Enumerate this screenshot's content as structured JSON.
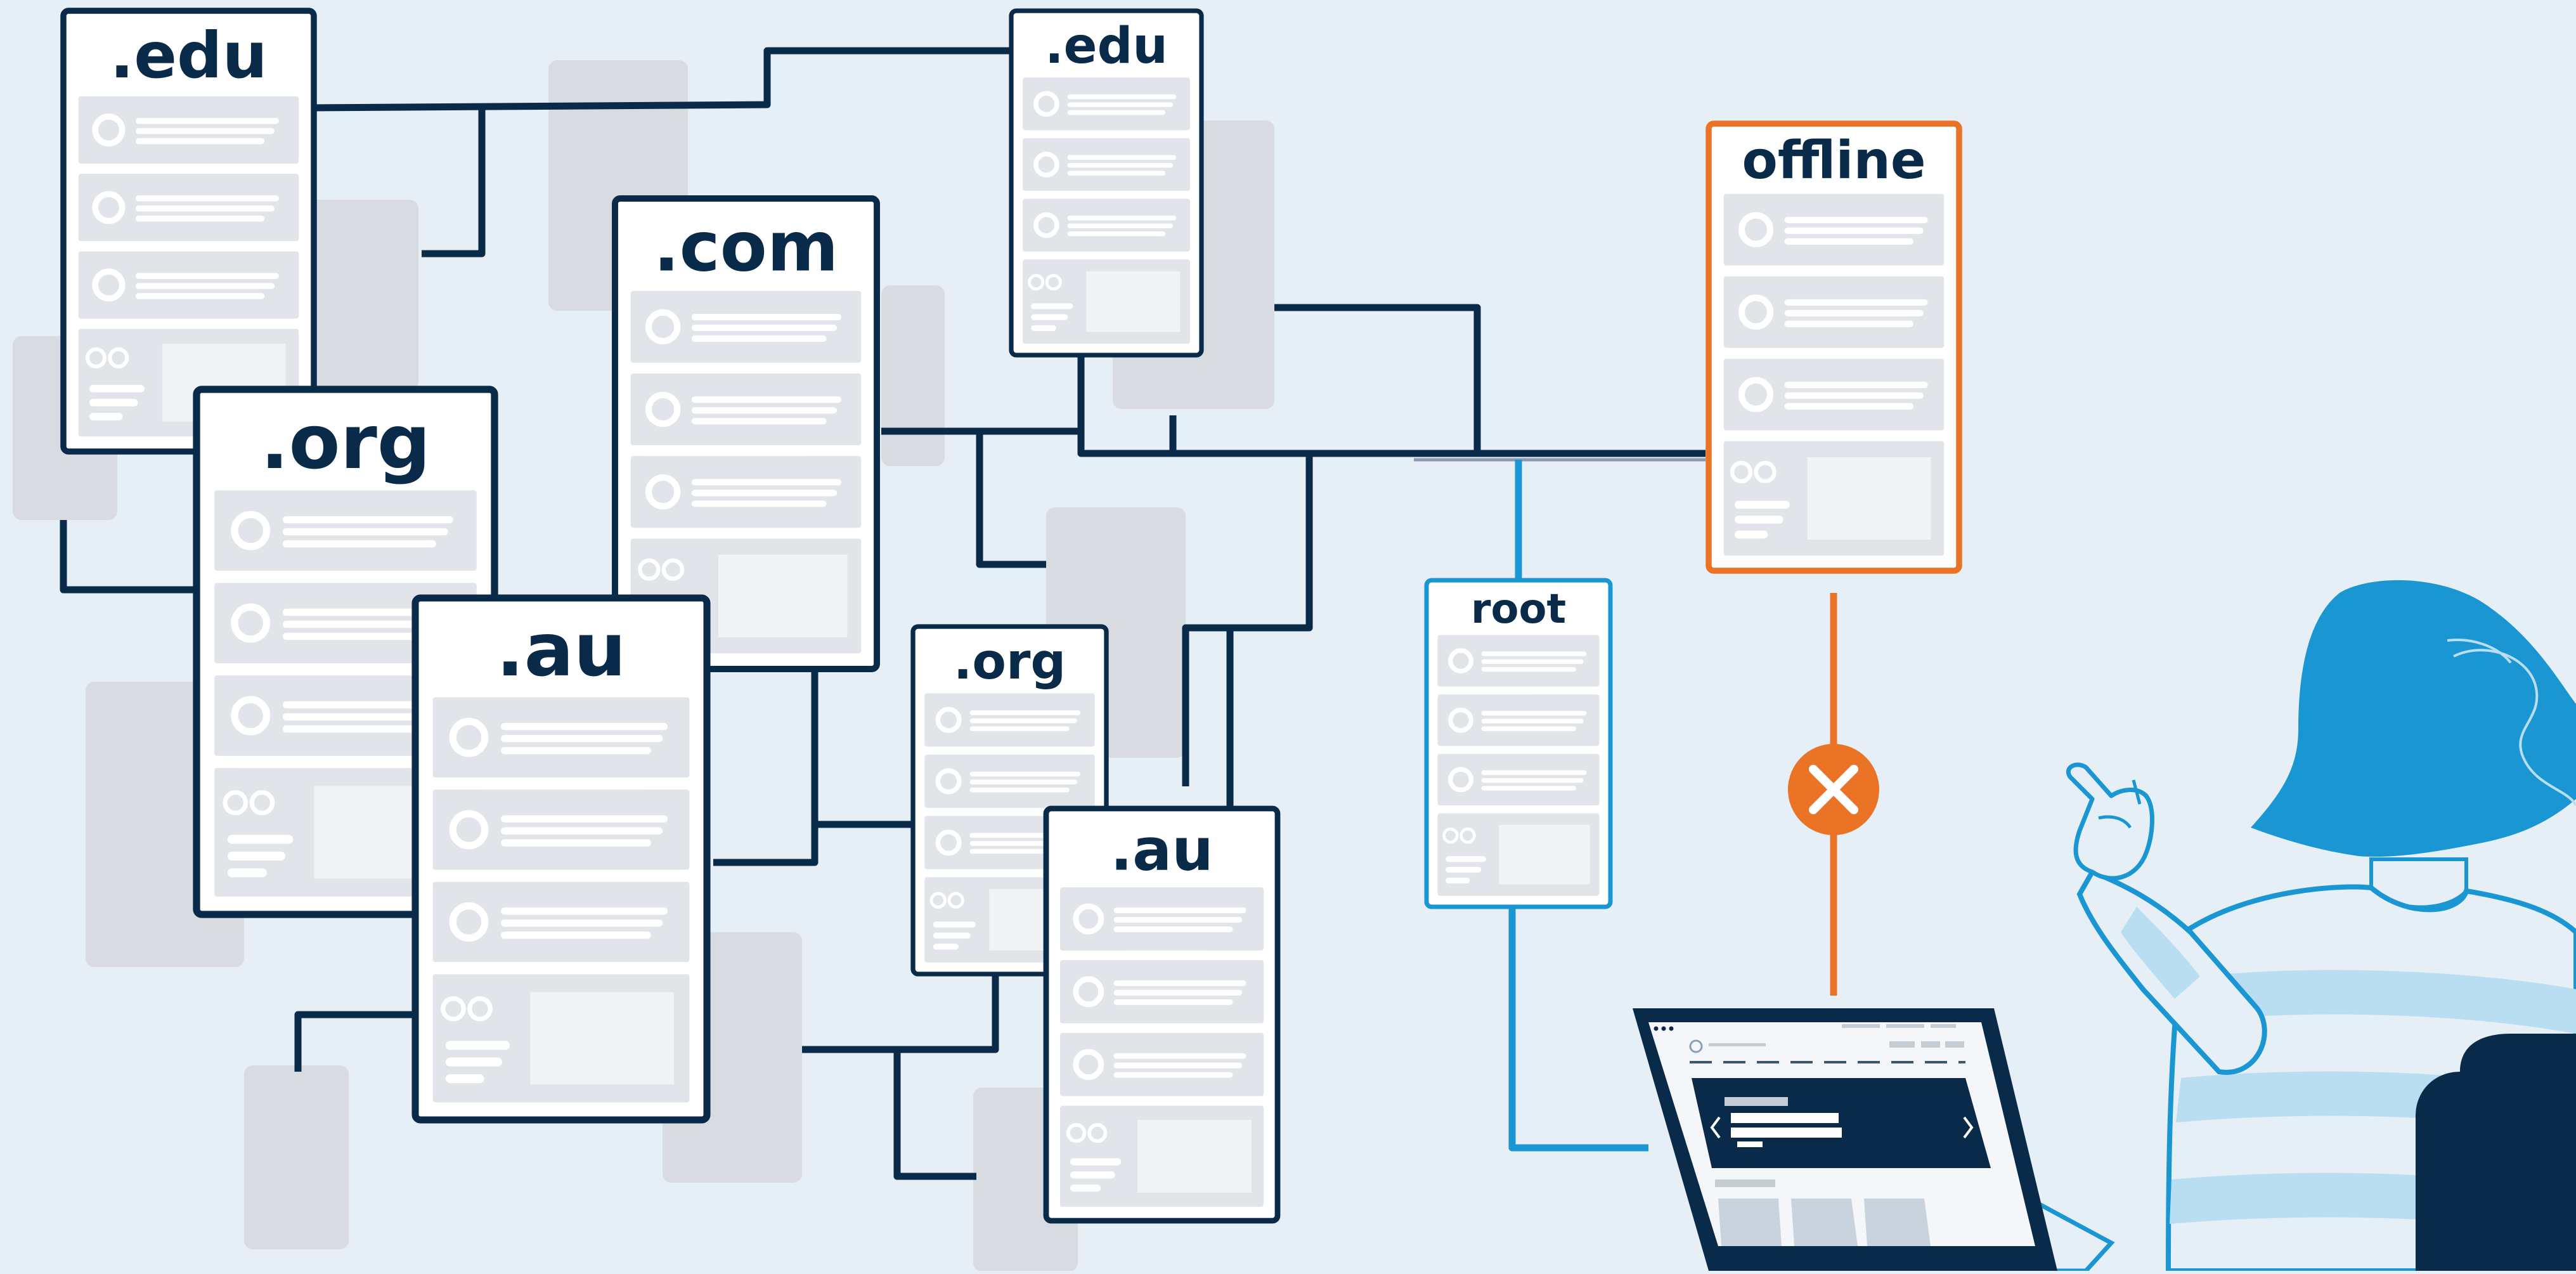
{
  "diagram": {
    "colors": {
      "background": "#e6eef6",
      "navy": "#0a2a4a",
      "blue": "#1a96d2",
      "orange": "#eb7326",
      "gray_block": "#d8dbdf",
      "card_row": "#e1e4e8",
      "light_blue_stripe": "#b9def2"
    },
    "servers": [
      {
        "label": ".edu",
        "color": "navy"
      },
      {
        "label": ".com",
        "color": "navy"
      },
      {
        "label": ".edu",
        "color": "navy"
      },
      {
        "label": ".org",
        "color": "navy"
      },
      {
        "label": ".au",
        "color": "navy"
      },
      {
        "label": ".org",
        "color": "navy"
      },
      {
        "label": ".au",
        "color": "navy"
      },
      {
        "label": "root",
        "color": "blue"
      },
      {
        "label": "offline",
        "color": "orange"
      }
    ],
    "connection_status": "broken",
    "status_icon": "x-icon",
    "person_icon": "person-pointing-icon",
    "laptop_icon": "laptop-icon"
  }
}
